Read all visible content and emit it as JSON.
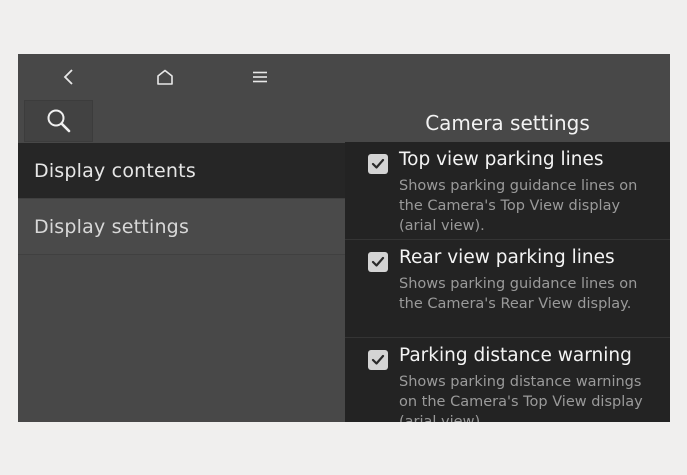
{
  "nav": {
    "back_icon": "chevron-left-icon",
    "home_icon": "home-icon",
    "menu_icon": "menu-icon",
    "search_icon": "search-icon"
  },
  "sidebar": {
    "items": [
      {
        "label": "Display contents",
        "selected": true
      },
      {
        "label": "Display settings",
        "selected": false
      }
    ]
  },
  "panel": {
    "title": "Camera settings",
    "options": [
      {
        "title": "Top view parking lines",
        "description": "Shows parking guidance lines on the Camera's Top View display (arial view).",
        "checked": true
      },
      {
        "title": "Rear view parking lines",
        "description": "Shows parking guidance lines on the Camera's Rear View display.",
        "checked": true
      },
      {
        "title": "Parking distance warning",
        "description": "Shows parking distance warnings on the Camera's Top View display (arial view).",
        "checked": true
      }
    ]
  },
  "colors": {
    "background": "#f0efee",
    "screen": "#484848",
    "selected_item": "#262626",
    "panel": "#232323",
    "checkbox": "#d4d4d4"
  }
}
